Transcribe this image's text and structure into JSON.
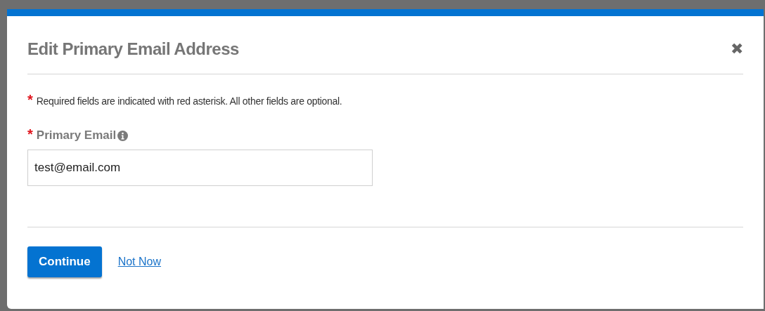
{
  "dialog": {
    "title": "Edit Primary Email Address",
    "close": "✖",
    "required_note": {
      "mark": "*",
      "text": "Required fields are indicated with red asterisk. All other fields are optional."
    },
    "fields": [
      {
        "mark": "*",
        "label": "Primary Email",
        "value": "test@email.com"
      }
    ],
    "buttons": [
      {
        "kind": "primary",
        "label": "Continue"
      },
      {
        "kind": "link",
        "label": "Not Now"
      }
    ]
  }
}
